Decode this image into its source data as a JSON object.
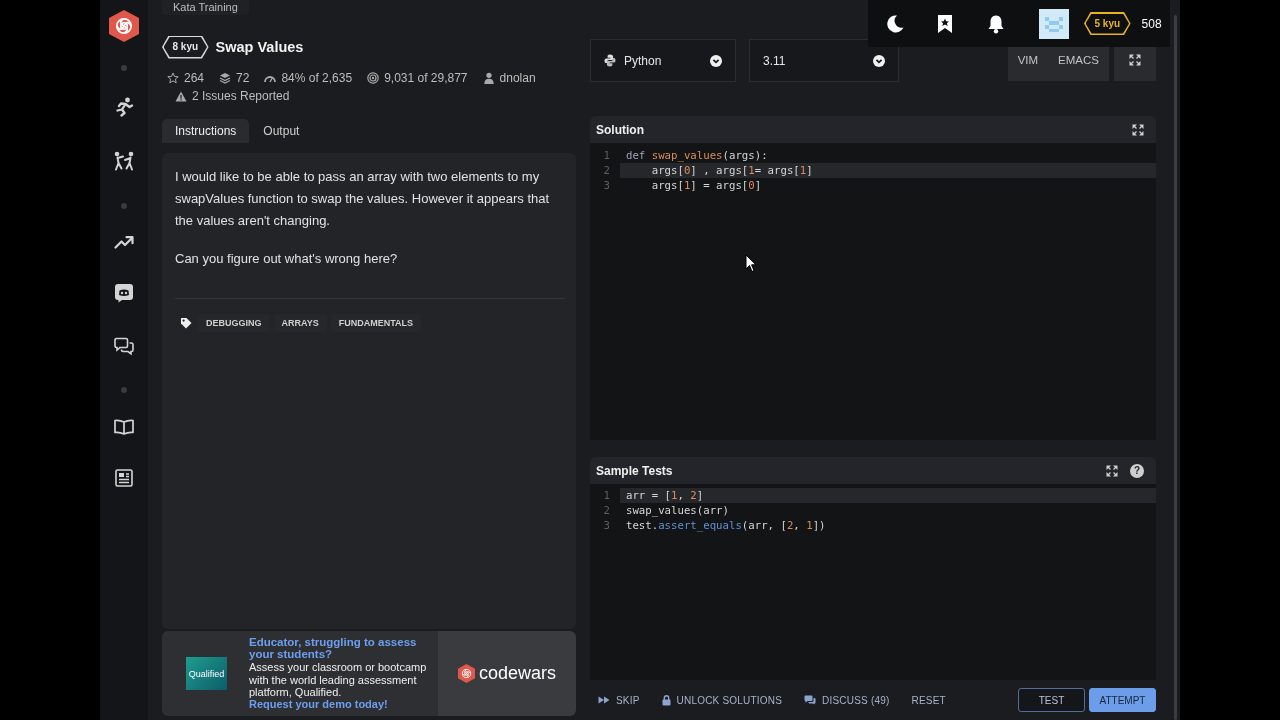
{
  "header": {
    "rank": "5 kyu",
    "honor": "508"
  },
  "kata": {
    "tooltip": "Kata Training",
    "rank": "8 kyu",
    "title": "Swap Values",
    "stats": [
      {
        "kind": "stars",
        "text": "264"
      },
      {
        "kind": "collections",
        "text": "72"
      },
      {
        "kind": "satisfaction",
        "text": "84% of 2,635"
      },
      {
        "kind": "completions",
        "text": "9,031 of 29,877"
      },
      {
        "kind": "author",
        "text": "dnolan"
      }
    ],
    "issues": "2 Issues Reported",
    "tabs": [
      {
        "label": "Instructions",
        "selected": true
      },
      {
        "label": "Output",
        "selected": false
      }
    ],
    "description": [
      "I would like to be able to pass an array with two elements to my swapValues function to swap the values. However it appears that the values aren't changing.",
      "Can you figure out what's wrong here?"
    ],
    "tags": [
      "DEBUGGING",
      "ARRAYS",
      "FUNDAMENTALS"
    ]
  },
  "ad": {
    "logo": "Qualified",
    "headline": "Educator, struggling to assess your students?",
    "body": "Assess your classroom or bootcamp with the world leading assessment platform, Qualified.",
    "link": "Request your demo today!",
    "brand": "codewars"
  },
  "editor": {
    "language": "Python",
    "version": "3.11",
    "modes": [
      {
        "label": "VIM",
        "selected": false
      },
      {
        "label": "EMACS",
        "selected": false
      }
    ],
    "solution": {
      "title": "Solution",
      "lines": [
        {
          "number": "1",
          "active": false,
          "tokens": [
            {
              "kind": "keyword",
              "text": "def "
            },
            {
              "kind": "function",
              "text": "swap_values"
            },
            {
              "kind": "plain",
              "text": "(args):"
            }
          ]
        },
        {
          "number": "2",
          "active": true,
          "tokens": [
            {
              "kind": "plain",
              "text": "    args["
            },
            {
              "kind": "number",
              "text": "0"
            },
            {
              "kind": "plain",
              "text": "] , args["
            },
            {
              "kind": "number",
              "text": "1"
            },
            {
              "kind": "plain",
              "text": "= args["
            },
            {
              "kind": "number",
              "text": "1"
            },
            {
              "kind": "plain",
              "text": "]"
            }
          ]
        },
        {
          "number": "3",
          "active": false,
          "tokens": [
            {
              "kind": "plain",
              "text": "    args["
            },
            {
              "kind": "number",
              "text": "1"
            },
            {
              "kind": "plain",
              "text": "] = args["
            },
            {
              "kind": "number",
              "text": "0"
            },
            {
              "kind": "plain",
              "text": "]"
            }
          ]
        }
      ]
    },
    "sample_tests": {
      "title": "Sample Tests",
      "help": "?",
      "lines": [
        {
          "number": "1",
          "active": true,
          "tokens": [
            {
              "kind": "plain",
              "text": "arr = ["
            },
            {
              "kind": "number",
              "text": "1"
            },
            {
              "kind": "plain",
              "text": ", "
            },
            {
              "kind": "number",
              "text": "2"
            },
            {
              "kind": "plain",
              "text": "]"
            }
          ]
        },
        {
          "number": "2",
          "active": false,
          "tokens": [
            {
              "kind": "plain",
              "text": "swap_values(arr)"
            }
          ]
        },
        {
          "number": "3",
          "active": false,
          "tokens": [
            {
              "kind": "plain",
              "text": "test."
            },
            {
              "kind": "method",
              "text": "assert_equals"
            },
            {
              "kind": "plain",
              "text": "(arr, ["
            },
            {
              "kind": "number",
              "text": "2"
            },
            {
              "kind": "plain",
              "text": ", "
            },
            {
              "kind": "number",
              "text": "1"
            },
            {
              "kind": "plain",
              "text": "])"
            }
          ]
        }
      ]
    }
  },
  "actions": [
    {
      "kind": "skip",
      "label": "SKIP"
    },
    {
      "kind": "unlock",
      "label": "UNLOCK SOLUTIONS"
    },
    {
      "kind": "discuss",
      "label": "DISCUSS (49)"
    },
    {
      "kind": "reset",
      "label": "RESET"
    }
  ],
  "buttons": [
    {
      "kind": "outline",
      "label": "TEST"
    },
    {
      "kind": "primary",
      "label": "ATTEMPT"
    }
  ]
}
